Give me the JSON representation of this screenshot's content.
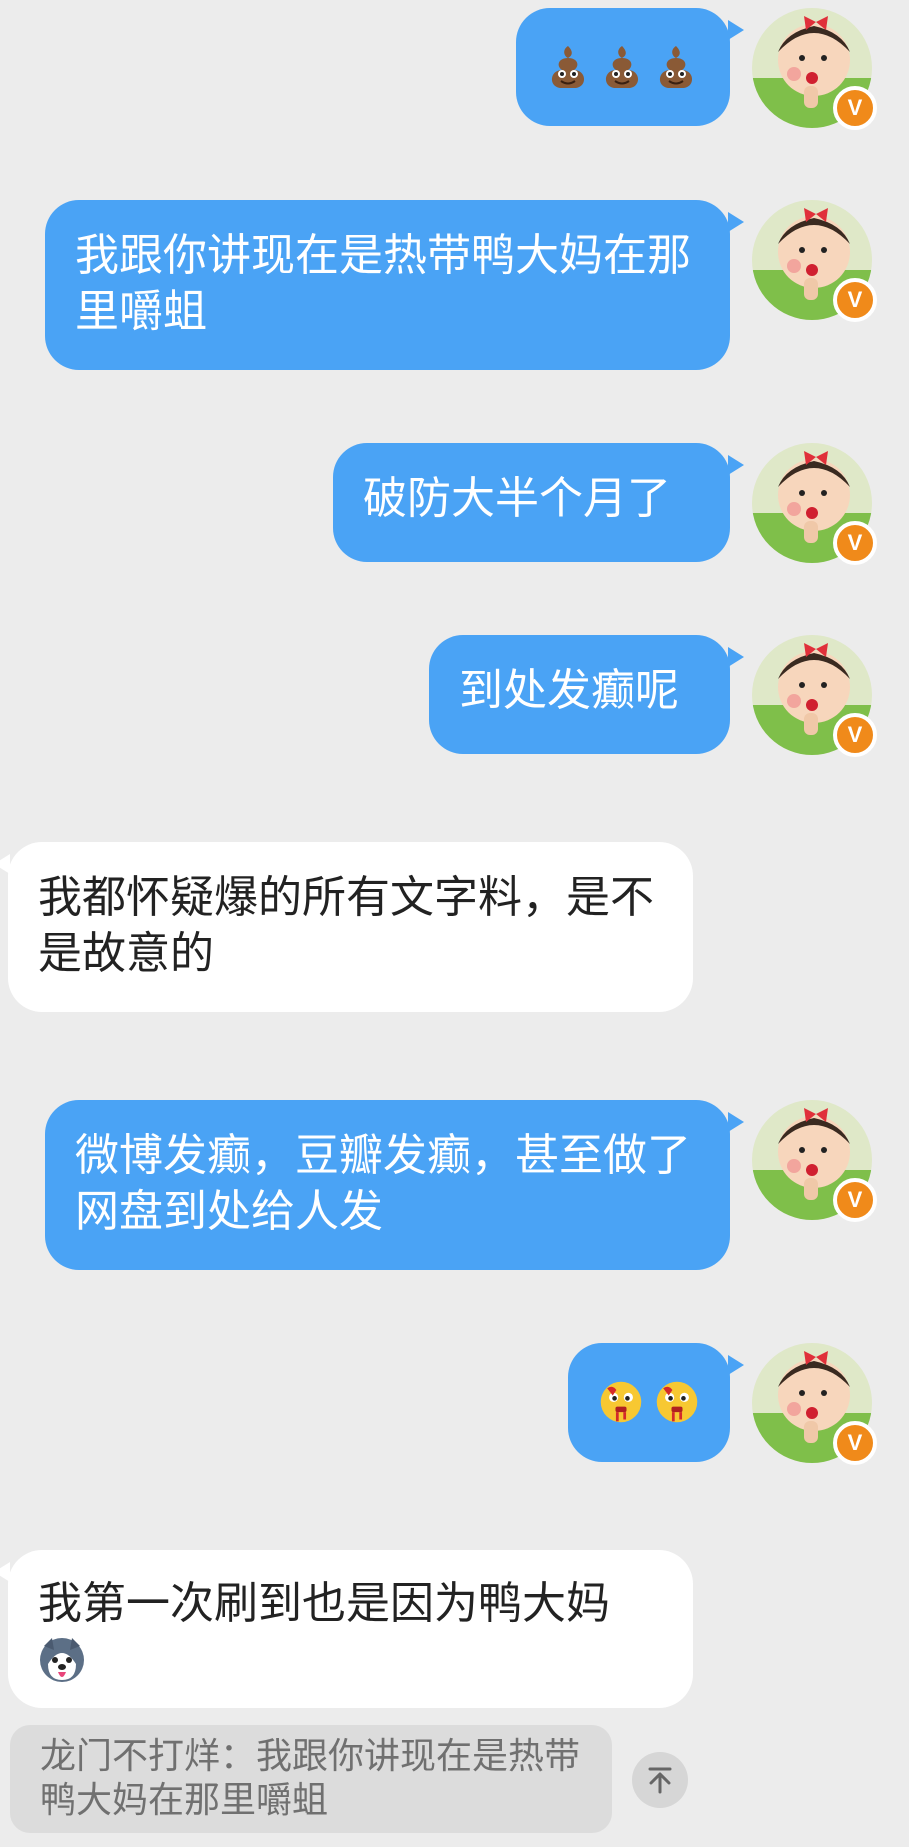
{
  "user": {
    "badge_letter": "V"
  },
  "messages": [
    {
      "id": "m1",
      "side": "me",
      "kind": "emoji",
      "emoji": "poop-emoji",
      "count": 3
    },
    {
      "id": "m2",
      "side": "me",
      "kind": "text",
      "text": "我跟你讲现在是热带鸭大妈在那里嚼蛆"
    },
    {
      "id": "m3",
      "side": "me",
      "kind": "text",
      "text": "破防大半个月了"
    },
    {
      "id": "m4",
      "side": "me",
      "kind": "text",
      "text": "到处发癫呢"
    },
    {
      "id": "m5",
      "side": "them",
      "kind": "text",
      "text": "我都怀疑爆的所有文字料，是不是故意的"
    },
    {
      "id": "m6",
      "side": "me",
      "kind": "text",
      "text": "微博发癫，豆瓣发癫，甚至做了网盘到处给人发"
    },
    {
      "id": "m7",
      "side": "me",
      "kind": "emoji",
      "emoji": "bleeding-face-emoji",
      "count": 2
    },
    {
      "id": "m8",
      "side": "them",
      "kind": "text+sticker",
      "text": "我第一次刷到也是因为鸭大妈",
      "sticker": "husky-dog-emoji"
    }
  ],
  "quote": {
    "text": "龙门不打烊：我跟你讲现在是热带鸭大妈在那里嚼蛆"
  },
  "colors": {
    "my_bubble": "#4aa3f5",
    "their_bubble": "#ffffff",
    "background": "#ececec",
    "badge": "#f08a1a"
  }
}
